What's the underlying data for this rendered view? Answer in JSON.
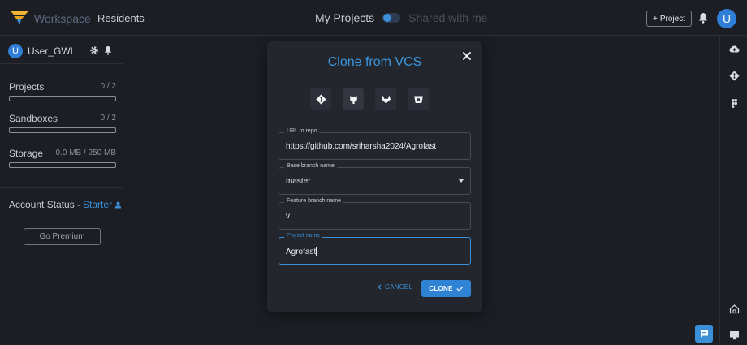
{
  "header": {
    "brand": "Workspace",
    "brand_sub": "Residents",
    "my_projects_label": "My Projects",
    "shared_label": "Shared with me",
    "new_project_label": "Project",
    "avatar_letter": "U"
  },
  "sidebar": {
    "user_name": "User_GWL",
    "avatar_letter": "U",
    "stats": [
      {
        "label": "Projects",
        "value": "0 / 2",
        "fill": 0.0
      },
      {
        "label": "Sandboxes",
        "value": "0 / 2",
        "fill": 0.0
      },
      {
        "label": "Storage",
        "value": "0.0 MB / 250 MB",
        "fill": 0.0
      }
    ],
    "account_status_label": "Account Status - ",
    "account_tier": "Starter",
    "go_premium_label": "Go Premium"
  },
  "modal": {
    "title": "Clone from VCS",
    "vcs_providers": [
      "git-icon",
      "github-icon",
      "gitlab-icon",
      "bitbucket-icon"
    ],
    "active_provider": "github-icon",
    "fields": {
      "url": {
        "label": "URL to repo",
        "value": "https://github.com/sriharsha2024/Agrofast"
      },
      "base_branch": {
        "label": "Base branch name",
        "value": "master"
      },
      "feature_branch": {
        "label": "Feature branch name",
        "value": "v"
      },
      "project_name": {
        "label": "Project name",
        "value": "Agrofast"
      }
    },
    "cancel_label": "CANCEL",
    "clone_label": "CLONE"
  },
  "colors": {
    "accent": "#3b8fd6",
    "background": "#1c1e24",
    "modal": "#23262d"
  }
}
